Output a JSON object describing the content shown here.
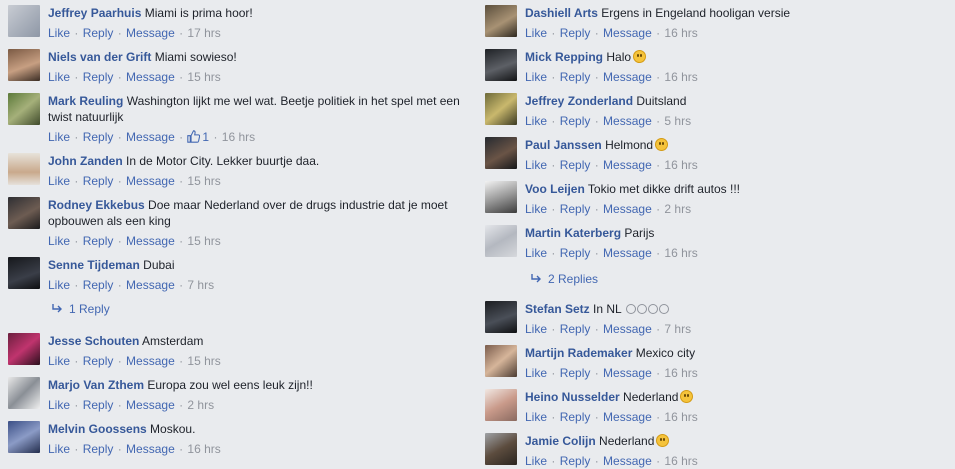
{
  "actions": {
    "like": "Like",
    "reply": "Reply",
    "message": "Message"
  },
  "left_comments": [
    {
      "author": "Jeffrey Paarhuis",
      "text": "Miami is prima hoor!",
      "time": "17 hrs"
    },
    {
      "author": "Niels van der Grift",
      "text": "Miami sowieso!",
      "time": "15 hrs"
    },
    {
      "author": "Mark Reuling",
      "text": "Washington lijkt me wel wat. Beetje politiek in het spel met een",
      "text2": "twist natuurlijk",
      "likes": "1",
      "time": "16 hrs"
    },
    {
      "author": "John Zanden",
      "text": "In de Motor City. Lekker buurtje daa.",
      "time": "15 hrs"
    },
    {
      "author": "Rodney Ekkebus",
      "text": "Doe maar Nederland over de drugs industrie dat je moet",
      "text2": "opbouwen als een king",
      "time": "15 hrs"
    },
    {
      "author": "Senne Tijdeman",
      "text": "Dubai",
      "time": "7 hrs",
      "replies": "1 Reply"
    },
    {
      "author": "Jesse Schouten",
      "text": "Amsterdam",
      "time": "15 hrs"
    },
    {
      "author": "Marjo Van Zthem",
      "text": "Europa zou wel eens leuk zijn!!",
      "time": "2 hrs"
    },
    {
      "author": "Melvin Goossens",
      "text": "Moskou.",
      "time": "16 hrs"
    }
  ],
  "right_comments": [
    {
      "author": "Dashiell Arts",
      "text": "Ergens in Engeland hooligan versie",
      "time": "16 hrs"
    },
    {
      "author": "Mick Repping",
      "text": "Halo",
      "time": "16 hrs"
    },
    {
      "author": "Jeffrey Zonderland",
      "text": "Duitsland",
      "time": "5 hrs"
    },
    {
      "author": "Paul Janssen",
      "text": "Helmond",
      "time": "16 hrs"
    },
    {
      "author": "Voo Leijen",
      "text": "Tokio met dikke drift autos !!!",
      "time": "2 hrs"
    },
    {
      "author": "Martin Katerberg",
      "text": "Parijs",
      "time": "16 hrs",
      "replies": "2 Replies"
    },
    {
      "author": "Stefan Setz",
      "text": "In NL",
      "time": "7 hrs"
    },
    {
      "author": "Martijn Rademaker",
      "text": "Mexico city",
      "time": "16 hrs"
    },
    {
      "author": "Heino Nusselder",
      "text": "Nederland",
      "time": "16 hrs"
    },
    {
      "author": "Jamie Colijn",
      "text": "Nederland",
      "time": "16 hrs"
    }
  ]
}
